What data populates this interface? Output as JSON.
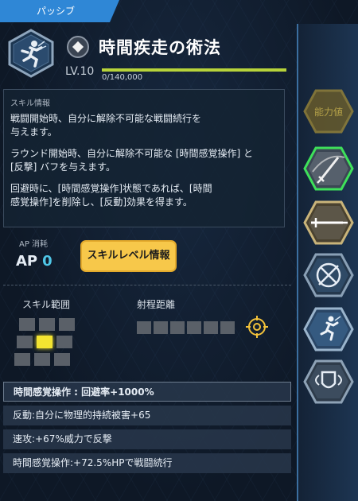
{
  "tab": {
    "label": "パッシブ"
  },
  "skill": {
    "title": "時間疾走の術法",
    "level": "LV.10",
    "exp_text": "0/140,000",
    "exp_fraction": 0.0
  },
  "description": {
    "header": "スキル情報",
    "paragraphs": [
      "戦闘開始時、自分に解除不可能な戦闘続行を\n与えます。",
      "ラウンド開始時、自分に解除不可能な [時間感覚操作] と\n[反撃] バフを与えます。",
      "回避時に、[時間感覚操作]状態であれば、[時間\n感覚操作]を削除し、[反動]効果を得ます。"
    ]
  },
  "ap": {
    "label": "AP 消耗",
    "prefix": "AP",
    "value": "0"
  },
  "level_info_button": "スキルレベル情報",
  "range": {
    "label": "スキル範囲"
  },
  "distance": {
    "label": "射程距離"
  },
  "stats": [
    "時間感覚操作 : 回避率+1000%",
    "反動:自分に物理的持続被害+65",
    "速攻:+67%威力で反撃",
    "時間感覚操作:+72.5%HPで戦闘続行"
  ],
  "rail": {
    "locked_label": "能力値",
    "icons": [
      "sword-slash-icon",
      "sword-icon",
      "crossed-bow-icon",
      "running-figure-icon",
      "winged-shield-icon"
    ]
  },
  "colors": {
    "accent": "#2f87d6",
    "ap_value": "#4fc6e6",
    "button": "#f7c84a",
    "exp": "#b7d33a",
    "highlight_cell": "#f3e431"
  }
}
